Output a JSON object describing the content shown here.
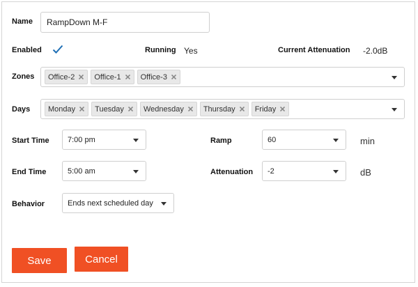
{
  "form": {
    "name_label": "Name",
    "name_value": "RampDown M-F",
    "enabled_label": "Enabled",
    "enabled_checked": true,
    "running_label": "Running",
    "running_value": "Yes",
    "current_attenuation_label": "Current Attenuation",
    "current_attenuation_value": "-2.0dB",
    "zones_label": "Zones",
    "zones": [
      "Office-2",
      "Office-1",
      "Office-3"
    ],
    "days_label": "Days",
    "days": [
      "Monday",
      "Tuesday",
      "Wednesday",
      "Thursday",
      "Friday"
    ],
    "start_time_label": "Start Time",
    "start_time_value": "7:00 pm",
    "end_time_label": "End Time",
    "end_time_value": "5:00 am",
    "behavior_label": "Behavior",
    "behavior_value": "Ends next scheduled day",
    "ramp_label": "Ramp",
    "ramp_value": "60",
    "ramp_unit": "min",
    "attenuation_label": "Attenuation",
    "attenuation_value": "-2",
    "attenuation_unit": "dB"
  },
  "actions": {
    "save_label": "Save",
    "cancel_label": "Cancel"
  },
  "colors": {
    "accent": "#f05024",
    "check": "#1e6fb5"
  },
  "icons": {
    "remove": "x-icon",
    "dropdown": "chevron-down-icon",
    "check": "check-icon"
  }
}
